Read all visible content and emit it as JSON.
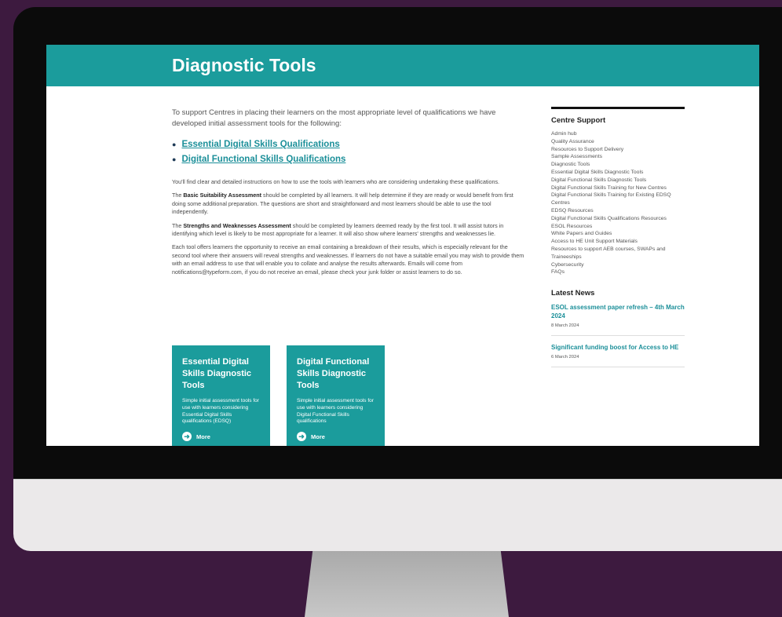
{
  "colors": {
    "accent": "#1b9c9c",
    "background": "#3d1a3f",
    "link": "#1b8f99"
  },
  "page": {
    "title": "Diagnostic Tools",
    "intro": "To support Centres in placing their learners on the most appropriate level of qualifications we have developed initial assessment tools for the following:",
    "links": [
      "Essential Digital Skills Qualifications",
      "Digital Functional Skills Qualifications"
    ],
    "para1": "You'll find clear and detailed instructions on how to use the tools with learners who are considering undertaking these qualifications.",
    "para2_bold": "Basic Suitability Assessment",
    "para2_rest": " should be completed by all learners. It will help determine if they are ready or would benefit from first doing some additional preparation. The questions are short and straightforward and most learners should be able to use the tool independently.",
    "para2_lead": "The ",
    "para3_lead": "The ",
    "para3_bold": "Strengths and Weaknesses Assessment",
    "para3_rest": " should be completed by learners deemed ready by the first tool. It will assist tutors in identifying which level is likely to be most appropriate for a learner. It will also show where learners' strengths and weaknesses lie.",
    "para4": "Each tool offers learners the opportunity to receive an email containing a breakdown of their results, which is especially relevant for the second tool where their answers will reveal strengths and weaknesses. If learners do not have a suitable email you may wish to provide them with an email address to use that will enable you to collate and analyse the results afterwards. Emails will come from notifications@typeform.com, if you do not receive an email, please check your junk folder or assist learners to do so."
  },
  "cards": [
    {
      "title": "Essential Digital Skills Diagnostic Tools",
      "desc": "Simple initial assessment tools for use with learners considering Essential Digital Skills qualifications (EDSQ)",
      "more": "More"
    },
    {
      "title": "Digital Functional Skills Diagnostic Tools",
      "desc": "Simple initial assessment tools for use with learners considering Digital Functional Skills qualifications",
      "more": "More"
    }
  ],
  "sidebar": {
    "heading": "Centre Support",
    "items": [
      "Admin hub",
      "Quality Assurance",
      "Resources to Support Delivery",
      "Sample Assessments",
      "Diagnostic Tools",
      "Essential Digital Skills Diagnostic Tools",
      "Digital Functional Skills Diagnostic Tools",
      "Digital Functional Skills Training for New Centres",
      "Digital Functional Skills Training for Existing EDSQ Centres",
      "EDSQ Resources",
      "Digital Functional Skills Qualifications Resources",
      "ESOL Resources",
      "White Papers and Guides",
      "Access to HE Unit Support Materials",
      "Resources to support AEB courses, SWAPs and Traineeships",
      "Cybersecurity",
      "FAQs"
    ],
    "news_heading": "Latest News",
    "news": [
      {
        "title": "ESOL assessment paper refresh – 4th March 2024",
        "date": "8 March 2024"
      },
      {
        "title": "Significant funding boost for Access to HE",
        "date": "6 March 2024"
      }
    ]
  }
}
